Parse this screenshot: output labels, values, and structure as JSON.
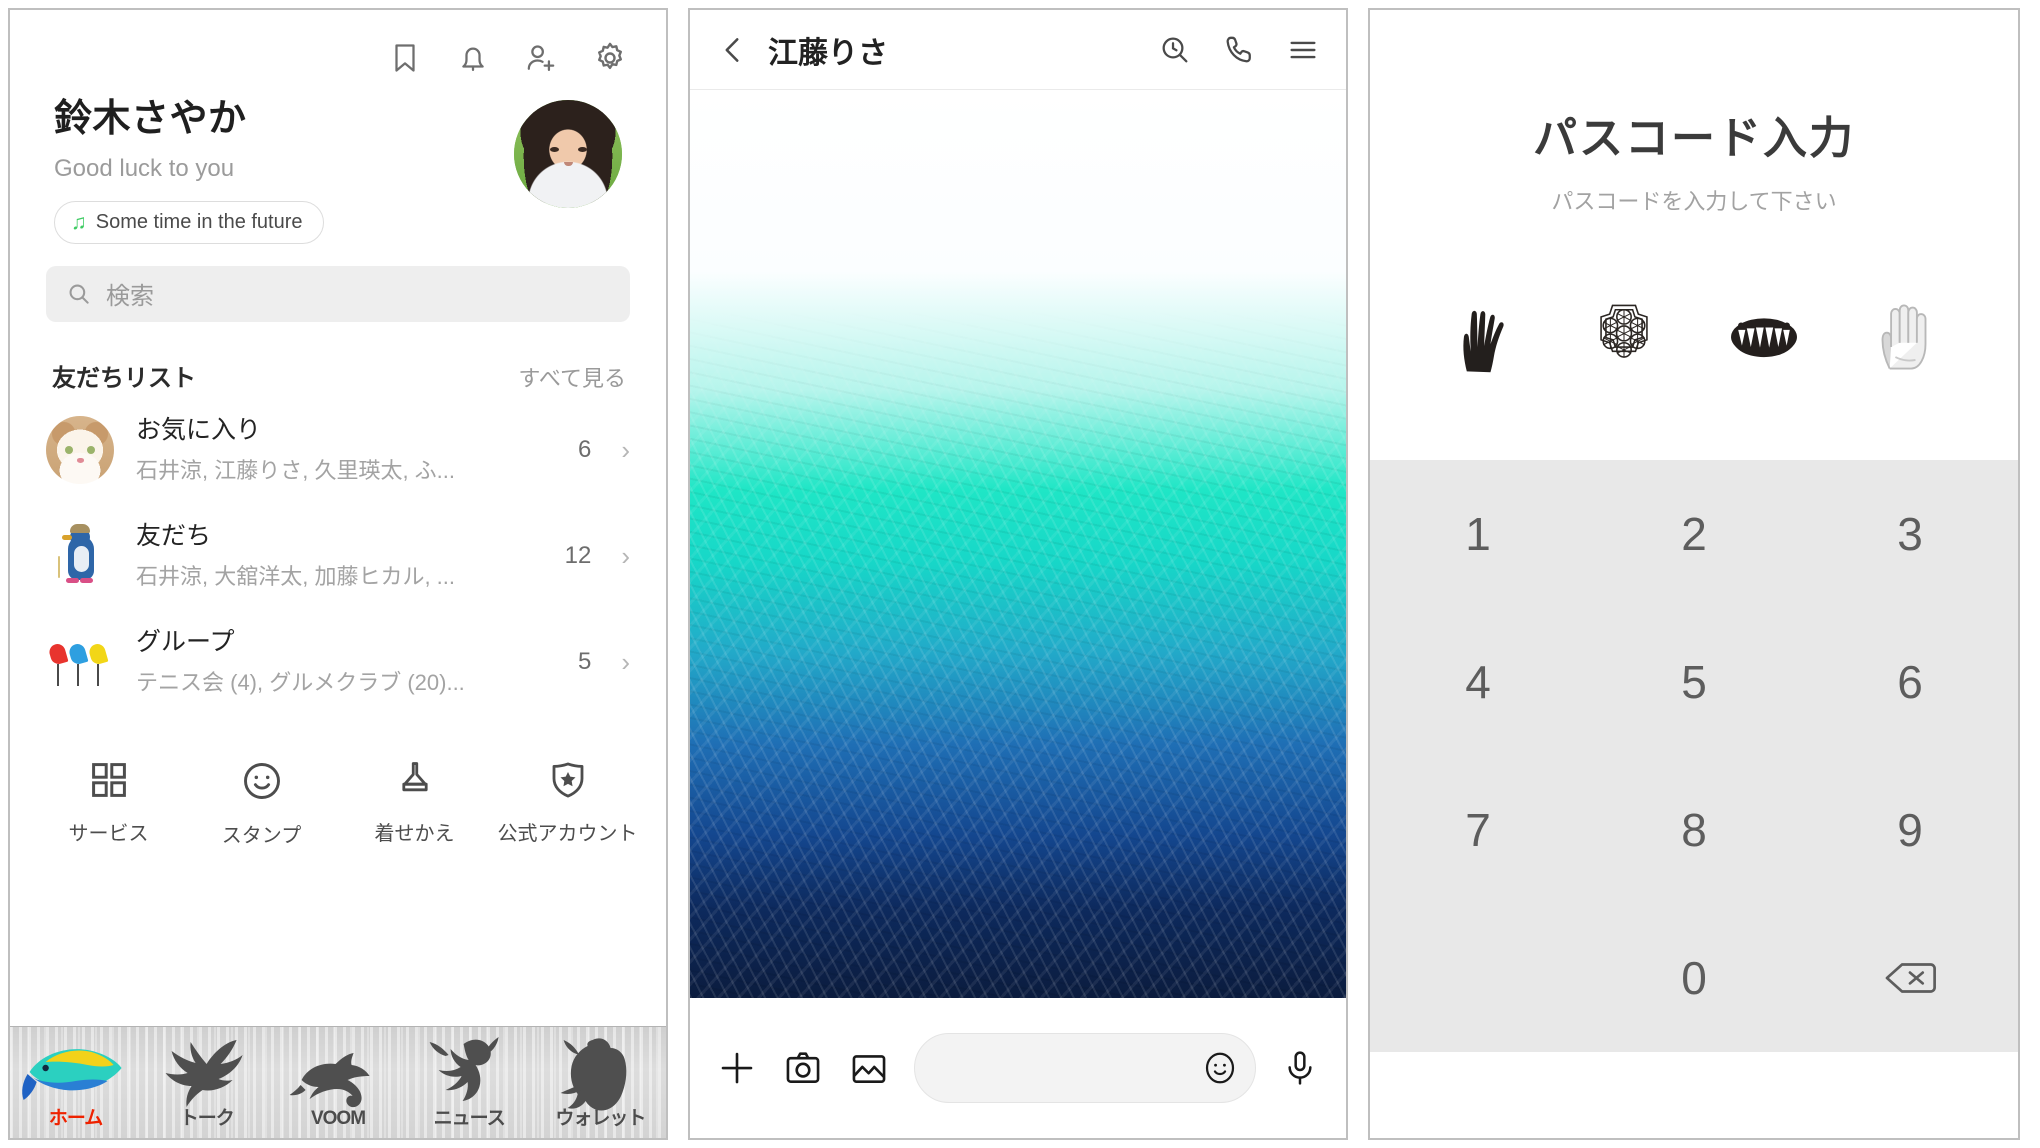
{
  "home": {
    "topbar_icons": [
      {
        "name": "bookmark-icon",
        "label": "Bookmark"
      },
      {
        "name": "bell-icon",
        "label": "Notifications"
      },
      {
        "name": "add-friend-icon",
        "label": "Add friend"
      },
      {
        "name": "gear-icon",
        "label": "Settings"
      }
    ],
    "profile": {
      "name": "鈴木さやか",
      "status_message": "Good luck to you",
      "music_chip": "Some time in the future",
      "music_icon": "music-note-icon"
    },
    "search": {
      "placeholder": "検索",
      "icon": "search-icon"
    },
    "friends_section": {
      "title": "友だちリスト",
      "action": "すべて見る",
      "rows": [
        {
          "name": "お気に入り",
          "subtitle": "石井涼, 江藤りさ, 久里瑛太, ふ...",
          "count": "6",
          "chevron": "›",
          "thumb": "cat-avatar"
        },
        {
          "name": "友だち",
          "subtitle": "石井涼, 大舘洋太, 加藤ヒカル, ...",
          "count": "12",
          "chevron": "›",
          "thumb": "penguin-avatar"
        },
        {
          "name": "グループ",
          "subtitle": "テニス会 (4), グルメクラブ (20)...",
          "count": "5",
          "chevron": "›",
          "thumb": "three-birds-avatar"
        }
      ]
    },
    "services": [
      {
        "label": "サービス",
        "icon": "grid-icon"
      },
      {
        "label": "スタンプ",
        "icon": "smiley-icon"
      },
      {
        "label": "着せかえ",
        "icon": "brush-icon"
      },
      {
        "label": "公式アカウント",
        "icon": "shield-star-icon"
      }
    ],
    "bottom_nav": {
      "active_color": "#ee2200",
      "items": [
        {
          "label": "ホーム",
          "icon": "rainbow-fish-icon",
          "active": true
        },
        {
          "label": "トーク",
          "icon": "eagle-icon",
          "active": false
        },
        {
          "label": "VOOM",
          "icon": "lizard-icon",
          "active": false
        },
        {
          "label": "ニュース",
          "icon": "scorpion-icon",
          "active": false
        },
        {
          "label": "ウォレット",
          "icon": "bear-icon",
          "active": false
        }
      ]
    }
  },
  "chat": {
    "header": {
      "back_icon": "chevron-left-icon",
      "title": "江藤りさ",
      "actions": [
        {
          "name": "search-history-icon",
          "label": "Search"
        },
        {
          "name": "phone-icon",
          "label": "Call"
        },
        {
          "name": "menu-icon",
          "label": "Menu"
        }
      ]
    },
    "wallpaper": {
      "description": "teal-to-navy painted gradient wallpaper",
      "colors": [
        "#ffffff",
        "#1fe6c6",
        "#22a9c9",
        "#14478f",
        "#0b1c3e"
      ]
    },
    "input_bar": {
      "plus_icon": "plus-icon",
      "camera_icon": "camera-icon",
      "gallery_icon": "image-icon",
      "message_placeholder": "",
      "emoji_icon": "smiley-icon",
      "mic_icon": "microphone-icon"
    }
  },
  "lock": {
    "title": "パスコード入力",
    "subtitle": "パスコードを入力して下さい",
    "indicators": [
      {
        "name": "claw-hand-glyph",
        "filled": true
      },
      {
        "name": "gem-rosette-glyph",
        "filled": true
      },
      {
        "name": "toothed-ring-glyph",
        "filled": true
      },
      {
        "name": "open-hand-glyph",
        "filled": false
      }
    ],
    "keypad": {
      "background": "#e8e8e8",
      "keys": [
        "1",
        "2",
        "3",
        "4",
        "5",
        "6",
        "7",
        "8",
        "9",
        "",
        "0",
        "delete"
      ],
      "delete_icon": "backspace-icon"
    }
  }
}
